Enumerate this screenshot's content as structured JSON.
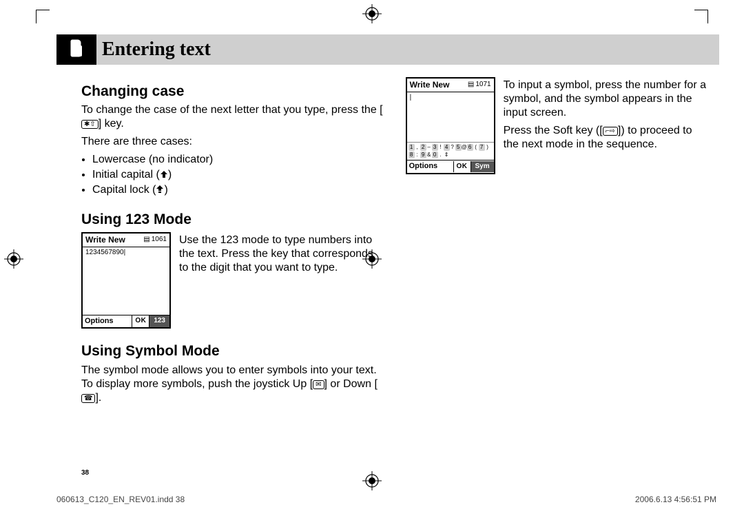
{
  "pageTitle": "Entering text",
  "section1": {
    "heading": "Changing case",
    "p1a": "To change the case of the next letter that you type, press the [",
    "p1b": "] key.",
    "p2": "There are three cases:",
    "li1": "Lowercase (no indicator)",
    "li2a": "Initial capital (",
    "li2b": ")",
    "li3a": "Capital lock (",
    "li3b": ")"
  },
  "section2": {
    "heading": "Using 123 Mode",
    "para": "Use the 123 mode to type numbers into the text. Press the key that corresponds to the digit that you want to type."
  },
  "section3": {
    "heading": "Using Symbol Mode",
    "p1a": "The symbol mode allows you to enter symbols into your text. To display more symbols, push the joystick Up [",
    "p1b": "] or Down [",
    "p1c": "]."
  },
  "symbolPara1": "To input a symbol, press the number for a symbol, and the symbol appears in the input screen.",
  "symbolPara2a": "Press the Soft key ([",
  "symbolPara2b": "]) to proceed to the next mode in the sequence.",
  "screen123": {
    "title": "Write New",
    "counter": "1061",
    "body": "1234567890|",
    "options": "Options",
    "ok": "OK",
    "mode": "123"
  },
  "screenSym": {
    "title": "Write New",
    "counter": "1071",
    "body": "|",
    "options": "Options",
    "ok": "OK",
    "mode": "Sym"
  },
  "symbolKeys": {
    "n1": "1",
    "g1": ",",
    "n2": "2",
    "g2": "–",
    "n3": "3",
    "g3": "!",
    "n4": "4",
    "g4": "?",
    "n5": "5",
    "g5": "@",
    "n6": "6",
    "g6": "(",
    "n7": "7",
    "g7": ")",
    "n8": "8",
    "g8": ":",
    "n9": "9",
    "g9": "&",
    "n0": "0",
    "g0": "."
  },
  "pageNumber": "38",
  "footer": {
    "left": "060613_C120_EN_REV01.indd   38",
    "right": "2006.6.13   4:56:51 PM"
  }
}
